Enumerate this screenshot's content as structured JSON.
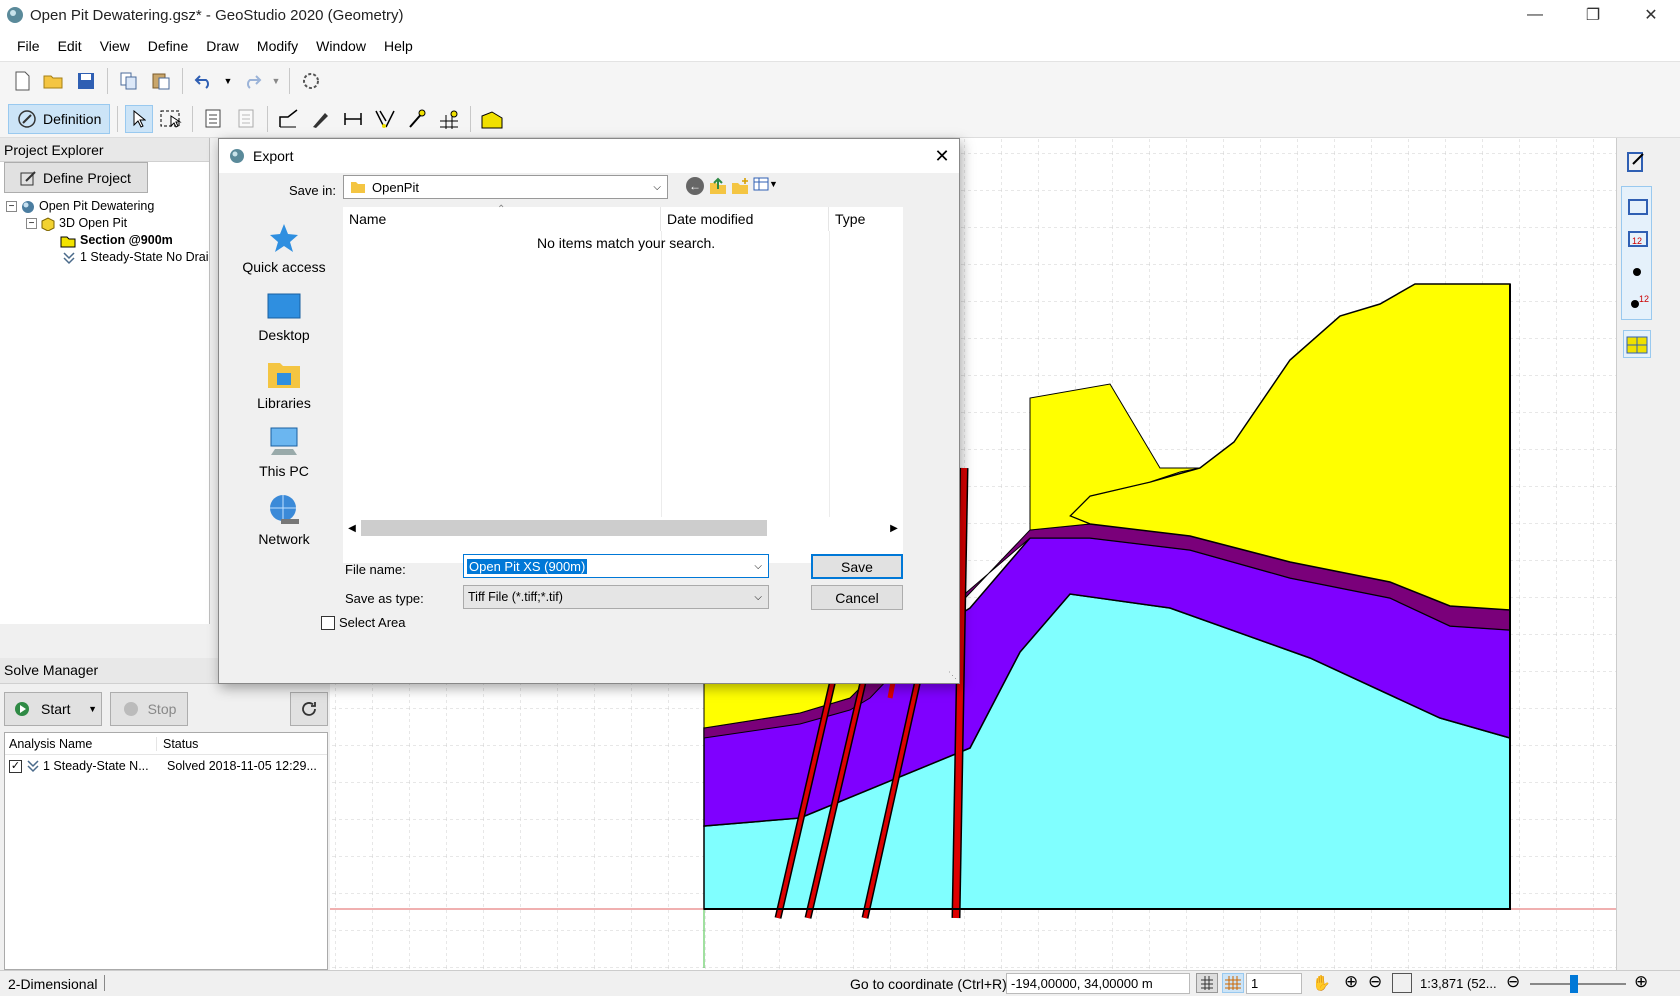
{
  "window": {
    "title": "Open Pit Dewatering.gsz* - GeoStudio 2020 (Geometry)"
  },
  "menu": [
    "File",
    "Edit",
    "View",
    "Define",
    "Draw",
    "Modify",
    "Window",
    "Help"
  ],
  "toolbar": {
    "definition_label": "Definition"
  },
  "project_explorer": {
    "title": "Project Explorer",
    "define_button": "Define Project",
    "tree": {
      "root": "Open Pit Dewatering",
      "child": "3D Open Pit",
      "section": "Section @900m",
      "analysis": "1 Steady-State No Drai"
    }
  },
  "solve_manager": {
    "title": "Solve Manager",
    "start_label": "Start",
    "stop_label": "Stop",
    "columns": [
      "Analysis Name",
      "Status"
    ],
    "rows": [
      {
        "name": "1 Steady-State N...",
        "status": "Solved 2018-11-05 12:29..."
      }
    ]
  },
  "dialog": {
    "title": "Export",
    "save_in_label": "Save in:",
    "save_in_value": "OpenPit",
    "places": [
      "Quick access",
      "Desktop",
      "Libraries",
      "This PC",
      "Network"
    ],
    "columns": [
      "Name",
      "Date modified",
      "Type"
    ],
    "empty_message": "No items match your search.",
    "file_name_label": "File name:",
    "file_name_value": "Open Pit XS (900m)",
    "type_label": "Save as type:",
    "type_value": "Tiff File (*.tiff;*.tif)",
    "save_button": "Save",
    "cancel_button": "Cancel",
    "select_area_label": "Select Area"
  },
  "status_bar": {
    "mode": "2-Dimensional",
    "goto_label": "Go to coordinate (Ctrl+R):",
    "coordinate": "-194,00000, 34,00000 m",
    "grid_value": "1",
    "scale": "1:3,871 (52..."
  },
  "colors": {
    "yellow": "#ffff00",
    "purple": "#7f00ff",
    "cyan": "#80ffff",
    "darkpurple": "#7a007a",
    "fault": "#dd0000"
  }
}
